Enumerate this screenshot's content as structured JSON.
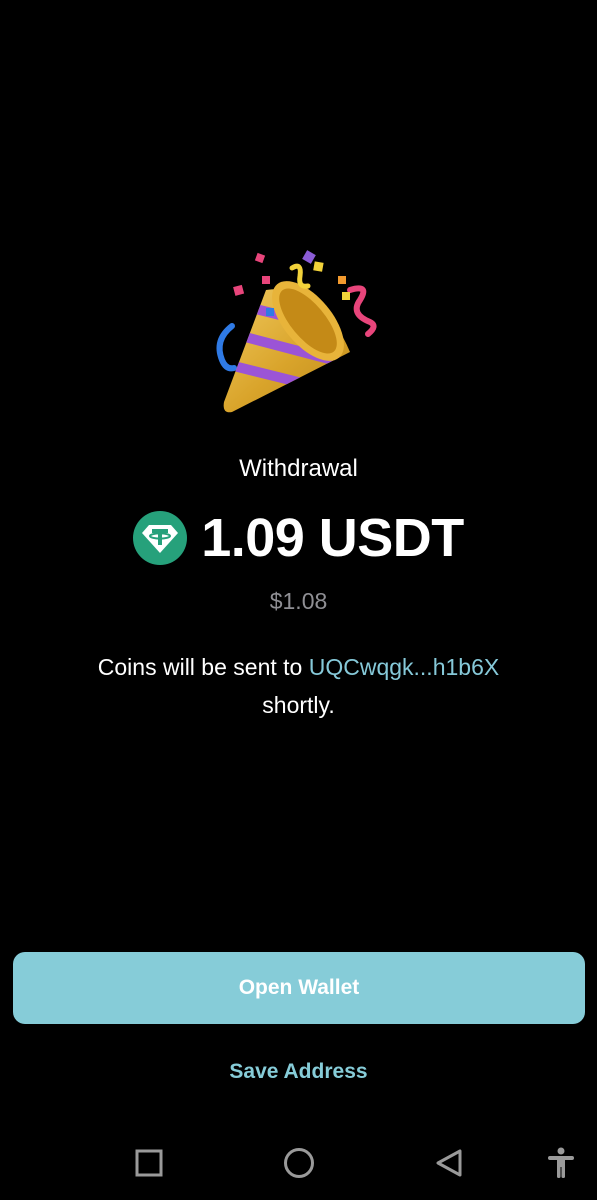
{
  "withdrawal": {
    "title": "Withdrawal",
    "amount": "1.09 USDT",
    "token_icon": "tether-icon",
    "fiat_amount": "$1.08",
    "message_prefix": "Coins will be sent to ",
    "address": "UQCwqgk...h1b6X",
    "message_suffix": "shortly."
  },
  "actions": {
    "open_wallet_label": "Open Wallet",
    "save_address_label": "Save Address"
  },
  "navbar": {
    "icons": [
      "recents-square-icon",
      "home-circle-icon",
      "back-triangle-icon",
      "accessibility-icon"
    ]
  },
  "colors": {
    "background": "#000000",
    "accent": "#86ccd8",
    "tether": "#26a17b",
    "muted_text": "#8f8f94"
  }
}
